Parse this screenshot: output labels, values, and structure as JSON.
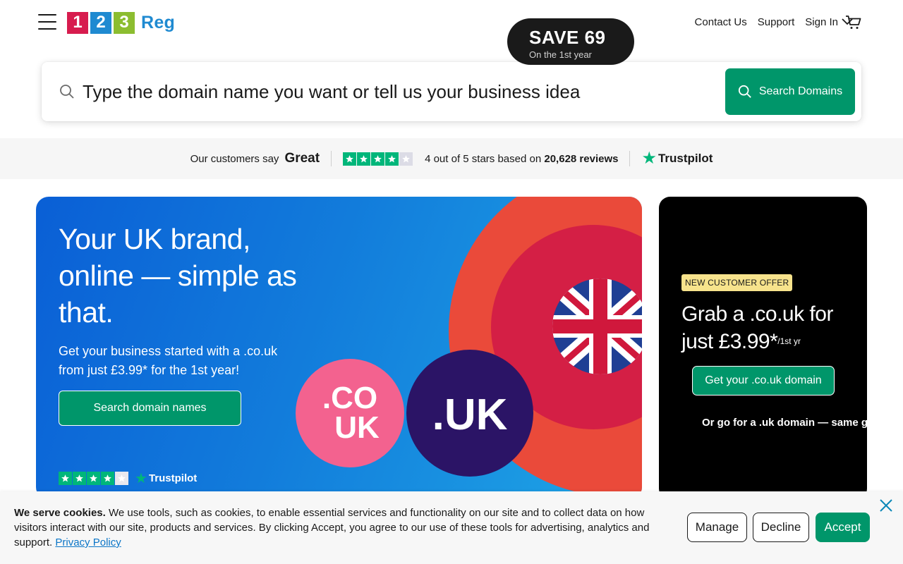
{
  "header": {
    "logo": {
      "digit1": "1",
      "digit2": "2",
      "digit3": "3",
      "word": "Reg"
    },
    "nav": {
      "contact": "Contact Us",
      "support": "Support",
      "sign_in": "Sign In"
    }
  },
  "search": {
    "placeholder": "Type the domain name you want or tell us your business idea",
    "button_label": "Search Domains"
  },
  "trust": {
    "prefix": "Our customers say",
    "rating_word": "Great",
    "stars_filled": 4,
    "stars_total": 5,
    "reviews_text_pre": "4 out of 5 stars based on",
    "reviews_count": "20,628 reviews",
    "brand": "Trustpilot"
  },
  "hero": {
    "title": "Your UK brand, online — simple as that.",
    "subtitle": "Get your business started with a .co.uk from just £3.99* for the 1st year!",
    "cta": "Search domain names",
    "save_big": "SAVE 69",
    "save_small": "On the 1st year",
    "badge_co": ".CO",
    "badge_uk_small": "UK",
    "badge_uk": ".UK",
    "trust_brand": "Trustpilot"
  },
  "offer": {
    "tag": "NEW CUSTOMER OFFER",
    "title": "Grab a .co.uk for just £3.99*",
    "title_suffix": "/1st yr",
    "cta": "Get your .co.uk domain",
    "alt_text": "Or go for a .uk domain — same g"
  },
  "cookie": {
    "lead": "We serve cookies.",
    "body": " We use tools, such as cookies, to enable essential services and functionality on our site and to collect data on how visitors interact with our site, products and services. By clicking Accept, you agree to our use of these tools for advertising, analytics and support. ",
    "link": "Privacy Policy",
    "manage": "Manage",
    "decline": "Decline",
    "accept": "Accept"
  },
  "colors": {
    "brand_green": "#00966a",
    "trust_green": "#00b67a",
    "logo_red": "#d71c4e",
    "logo_blue": "#1f8ad1",
    "logo_green": "#8cbd30"
  }
}
